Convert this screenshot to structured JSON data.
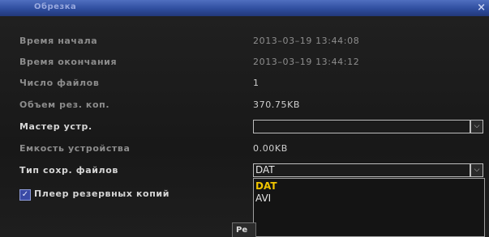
{
  "window": {
    "title": "Обрезка",
    "close_glyph": "×"
  },
  "rows": {
    "start_time": {
      "label": "Время начала",
      "value": "2013–03–19 13:44:08"
    },
    "end_time": {
      "label": "Время окончания",
      "value": "2013–03–19 13:44:12"
    },
    "file_count": {
      "label": "Число файлов",
      "value": "1"
    },
    "backup_size": {
      "label": "Объем рез. коп.",
      "value": "370.75KB"
    },
    "device_master": {
      "label": "Мастер устр.",
      "value": ""
    },
    "device_capacity": {
      "label": "Емкость устройства",
      "value": "0.00KB"
    },
    "file_type": {
      "label": "Тип сохр. файлов",
      "value": "DAT"
    }
  },
  "backup_player": {
    "label": "Плеер резервных копий",
    "checked": true,
    "check_glyph": "✓"
  },
  "file_type_options": [
    "DAT",
    "AVI"
  ],
  "bottom_button": {
    "label": "Ре"
  },
  "dropdown_glyph": "⌵",
  "colors": {
    "title_bar": "#2f4d9e",
    "selected_option": "#f0c400",
    "checkbox": "#3a4aa6"
  },
  "icons": {
    "close": "close-icon",
    "dropdown": "chevron-down-icon",
    "check": "checkmark-icon"
  }
}
